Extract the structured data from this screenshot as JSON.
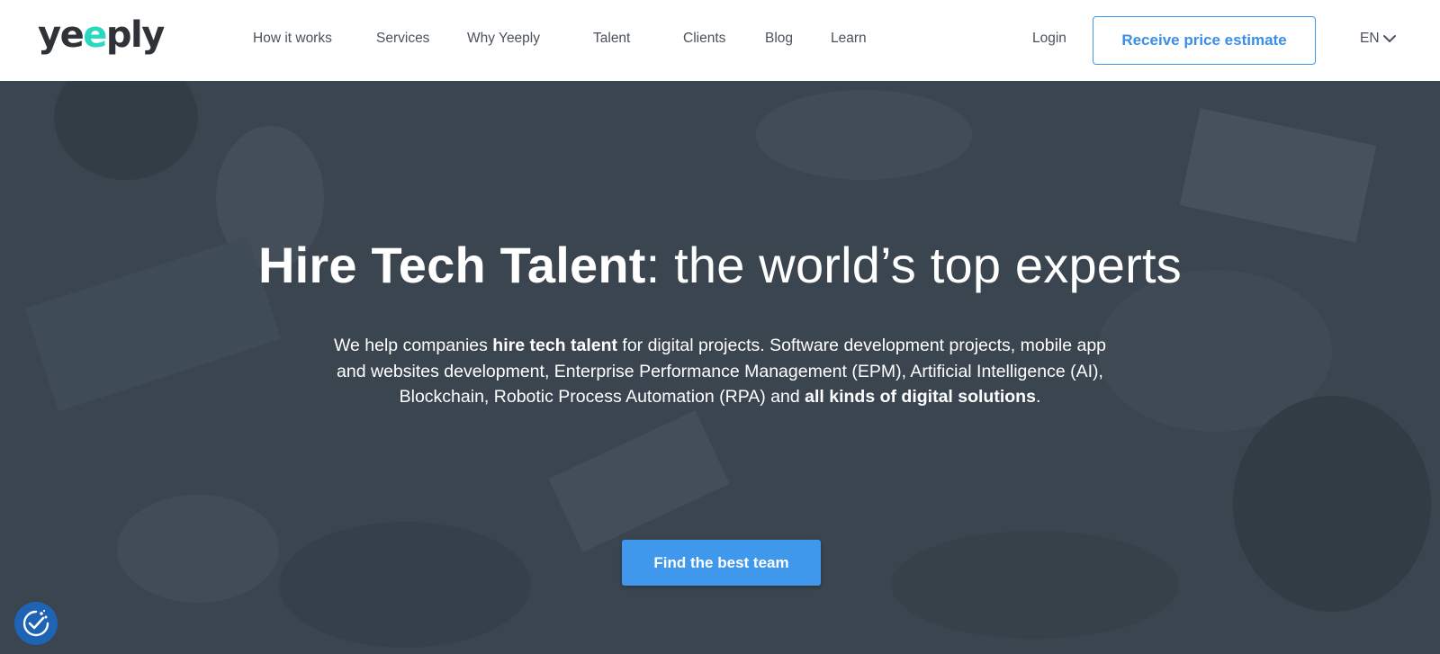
{
  "brand": {
    "logo_start": "ye",
    "logo_accent": "e",
    "logo_end": "ply",
    "accent_color": "#2ad8c2",
    "primary_color": "#3f98ec"
  },
  "nav": {
    "items": [
      "How it works",
      "Services",
      "Why Yeeply",
      "Talent",
      "Clients",
      "Blog",
      "Learn"
    ],
    "login": "Login",
    "estimate_button": "Receive price estimate",
    "language": "EN"
  },
  "hero": {
    "title_bold": "Hire Tech Talent",
    "title_rest": ": the world’s top experts",
    "text_1": "We help companies ",
    "text_2": "hire tech talent",
    "text_3": " for digital projects. Software development projects, mobile app and websites development, Enterprise Performance Management (EPM), Artificial Intelligence (AI), Blockchain, Robotic Process Automation (RPA) and ",
    "text_4": "all kinds of digital solutions",
    "text_5": ".",
    "cta": "Find the best team"
  },
  "icons": {
    "cookie": "cookie-consent-icon",
    "language": "chevron-down-icon"
  }
}
